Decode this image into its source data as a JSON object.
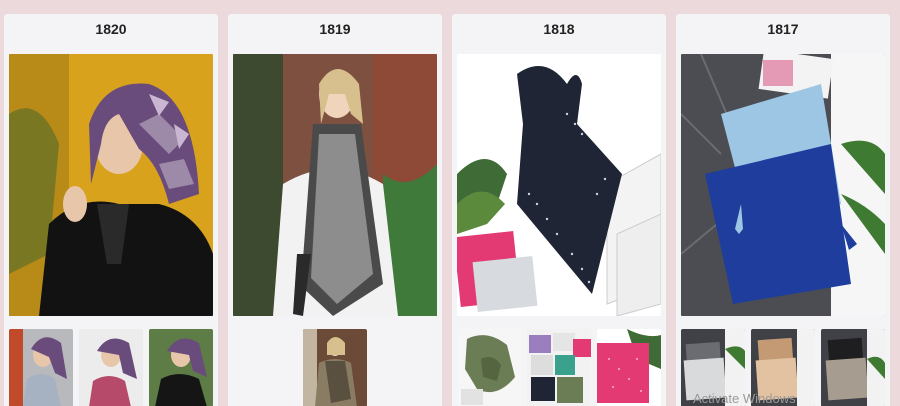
{
  "products": [
    {
      "id": "1820",
      "photo": "woman in purple-grey patterned silk scarf, black coat, yellow backdrop",
      "thumbs": [
        "thumb-1",
        "thumb-2",
        "thumb-3"
      ]
    },
    {
      "id": "1819",
      "photo": "blonde woman wearing black-and-white monogram long scarf",
      "thumbs": [
        "thumb-1"
      ]
    },
    {
      "id": "1818",
      "photo": "navy crystal-studded square scarf with gift boxes",
      "thumbs": [
        "thumb-1",
        "thumb-2",
        "thumb-3"
      ]
    },
    {
      "id": "1817",
      "photo": "light-blue and royal-blue tasseled scarves on marble",
      "thumbs": [
        "thumb-1",
        "thumb-2",
        "thumb-3"
      ]
    }
  ],
  "watermark": "Activate Windows",
  "colors": {
    "page_bg": "#ecd9dc",
    "card_bg": "#f4f4f6"
  }
}
